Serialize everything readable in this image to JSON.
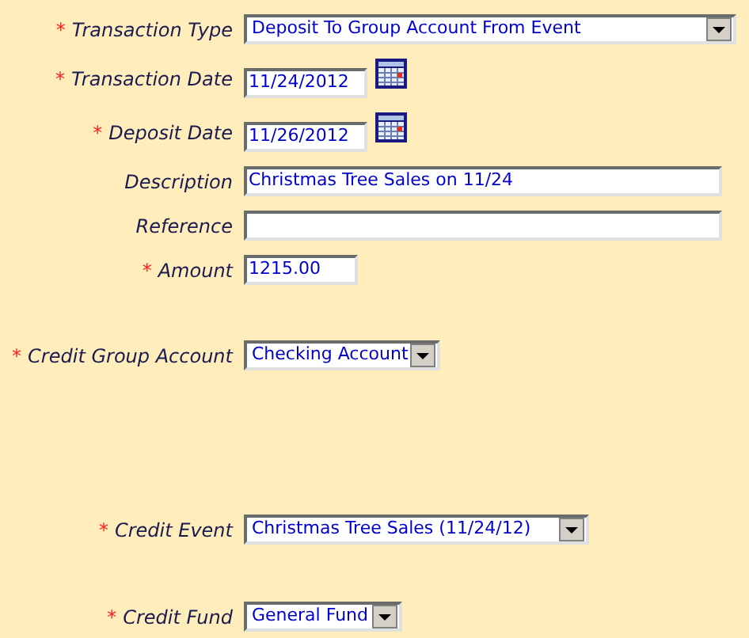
{
  "sections": [
    {
      "fields": [
        {
          "kind": "select",
          "mark": "*",
          "label": "Transaction Type",
          "value": "Deposit To Group Account From Event"
        },
        {
          "kind": "date",
          "mark": "*",
          "label": "Transaction Date",
          "value": "11/24/2012"
        },
        {
          "kind": "date",
          "mark": "*",
          "label": "Deposit Date",
          "value": "11/26/2012"
        },
        {
          "kind": "text",
          "label": "Description",
          "value": "Christmas Tree Sales on 11/24"
        },
        {
          "kind": "text",
          "label": "Reference"
        },
        {
          "kind": "amount",
          "mark": "*",
          "label": "Amount",
          "value": "1215.00"
        }
      ]
    },
    {
      "fields": [
        {
          "kind": "select",
          "mark": "*",
          "label": "Credit Group Account",
          "value": "Checking Account"
        }
      ]
    },
    {
      "fields": [
        {
          "kind": "select",
          "mark": "*",
          "label": "Credit Event",
          "value": "Christmas Tree Sales (11/24/12)"
        }
      ]
    },
    {
      "fields": [
        {
          "kind": "select",
          "mark": "*",
          "label": "Credit Fund",
          "value": "General Fund"
        }
      ]
    }
  ]
}
